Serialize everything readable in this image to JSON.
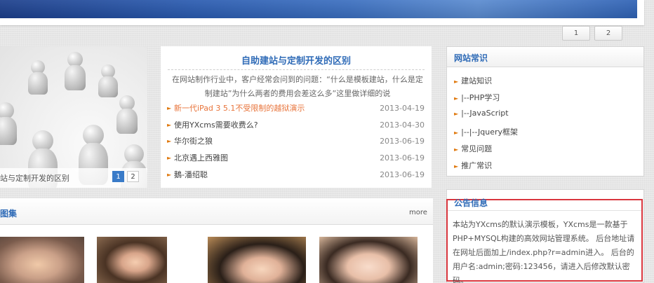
{
  "pager": [
    "1",
    "2"
  ],
  "slideshow": {
    "caption": "站与定制开发的区别",
    "dots": [
      "1",
      "2"
    ]
  },
  "article": {
    "title": "自助建站与定制开发的区别",
    "desc": "在网站制作行业中，客户经常会问到的问题：“什么是模板建站，什么是定制建站”为什么两者的费用会差这么多”这里做详细的说",
    "items": [
      {
        "title": "新一代iPad 3 5.1不受限制的越狱演示",
        "date": "2013-04-19"
      },
      {
        "title": "使用YXcms需要收费么?",
        "date": "2013-04-30"
      },
      {
        "title": "华尔街之狼",
        "date": "2013-06-19"
      },
      {
        "title": "北京遇上西雅图",
        "date": "2013-06-19"
      },
      {
        "title": "鵝-潘绍聪",
        "date": "2013-06-19"
      }
    ]
  },
  "knowledge": {
    "title": "网站常识",
    "items": [
      "建站知识",
      "|--PHP学习",
      "|--JavaScript",
      "|--|--Jquery框架",
      "常见问题",
      "推广常识"
    ]
  },
  "notice": {
    "title": "公告信息",
    "text": "本站为YXcms的默认演示模板，YXcms是一款基于PHP+MYSQL构建的高效网站管理系统。 后台地址请在网址后面加上/index.php?r=admin进入。 后台的用户名:admin;密码:123456，请进入后修改默认密码。"
  },
  "gallery": {
    "title": "图集",
    "more": "more"
  },
  "colors": {
    "accent": "#2f6bb7",
    "hot": "#e8743b",
    "bullet": "#e07a10",
    "highlight_border": "#d9363e"
  }
}
